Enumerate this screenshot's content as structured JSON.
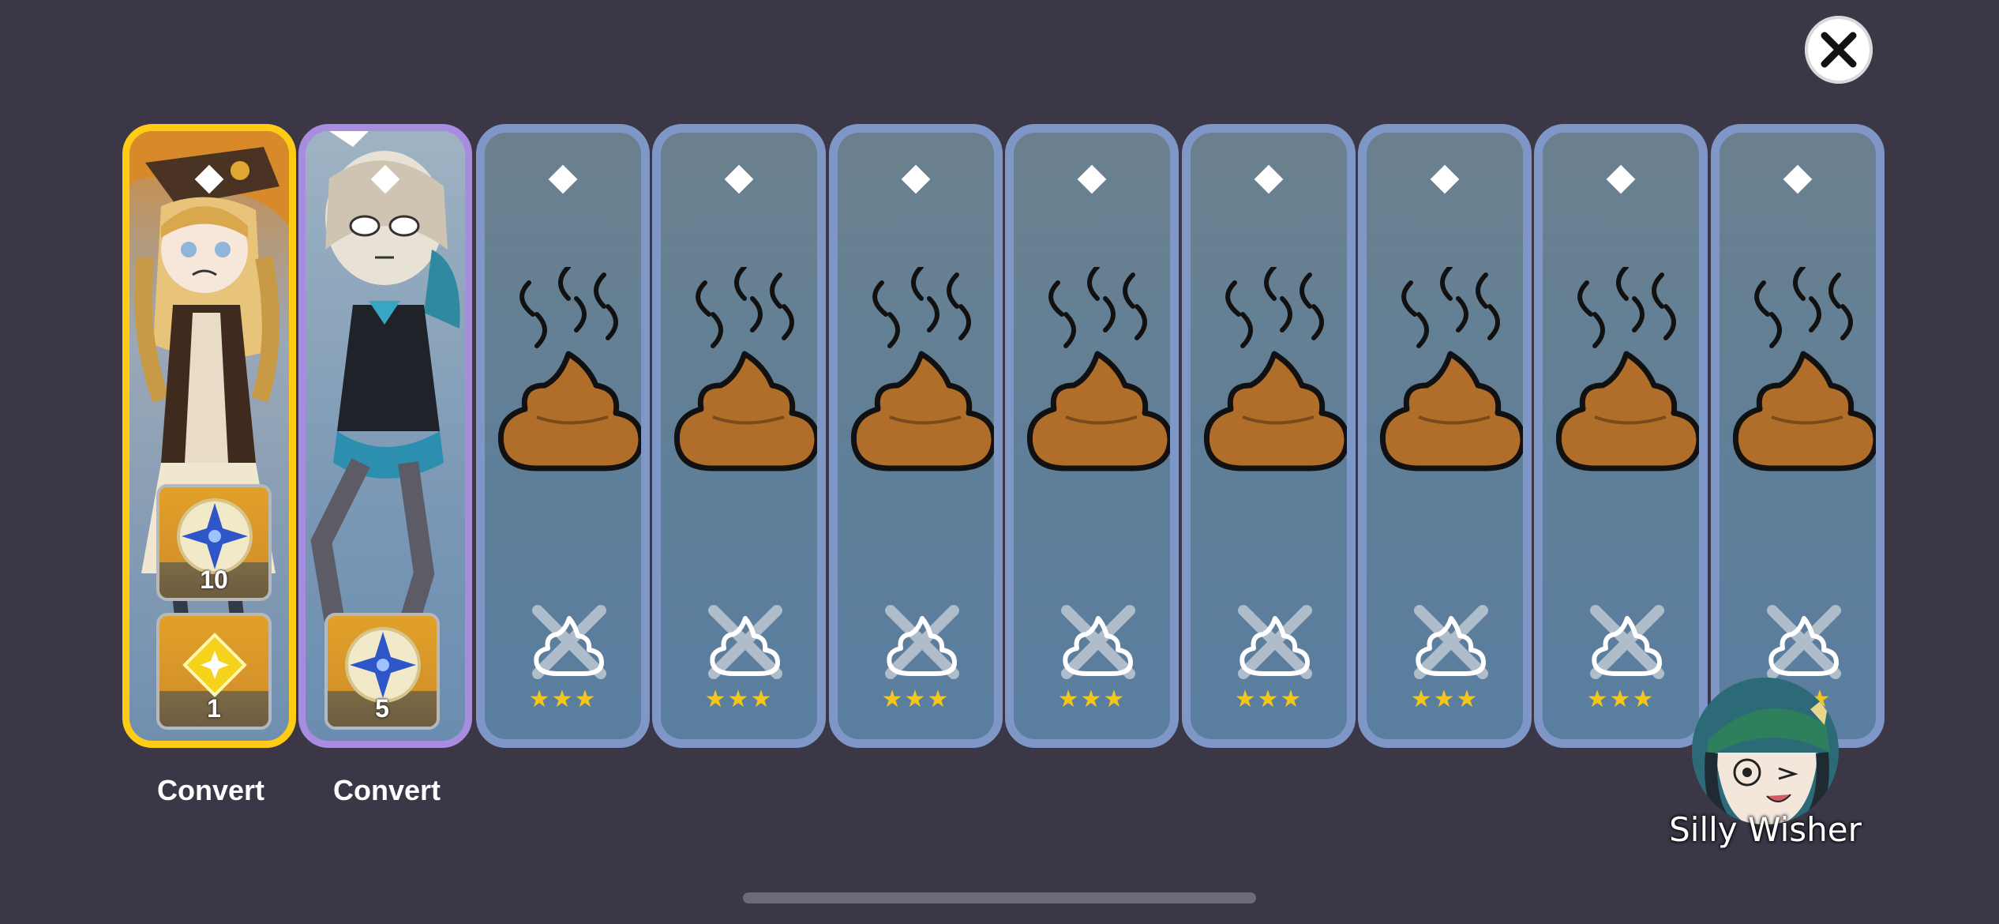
{
  "header": {
    "close_icon": "close-x-icon"
  },
  "results": [
    {
      "kind": "character",
      "frame": "gold",
      "color": "#ffcb14",
      "items": [
        {
          "icon": "fate-star-icon",
          "count": "10"
        },
        {
          "icon": "glitter-star-icon",
          "count": "1"
        }
      ],
      "convert_label": "Convert"
    },
    {
      "kind": "character",
      "frame": "purple",
      "color": "#a78ce0",
      "items": [
        {
          "icon": "fate-star-icon",
          "count": "5"
        }
      ],
      "convert_label": "Convert"
    },
    {
      "kind": "poop",
      "stars": "★★★"
    },
    {
      "kind": "poop",
      "stars": "★★★"
    },
    {
      "kind": "poop",
      "stars": "★★★"
    },
    {
      "kind": "poop",
      "stars": "★★★"
    },
    {
      "kind": "poop",
      "stars": "★★★"
    },
    {
      "kind": "poop",
      "stars": "★★★"
    },
    {
      "kind": "poop",
      "stars": "★★★"
    },
    {
      "kind": "poop",
      "stars": "★★★"
    }
  ],
  "wisher": {
    "name": "Silly Wisher",
    "avatar": "wisher-avatar-icon"
  },
  "colors": {
    "background": "#3b3747",
    "blue_frame": "#7e97c7",
    "star": "#f5c61a",
    "poop": "#b06e2a"
  }
}
